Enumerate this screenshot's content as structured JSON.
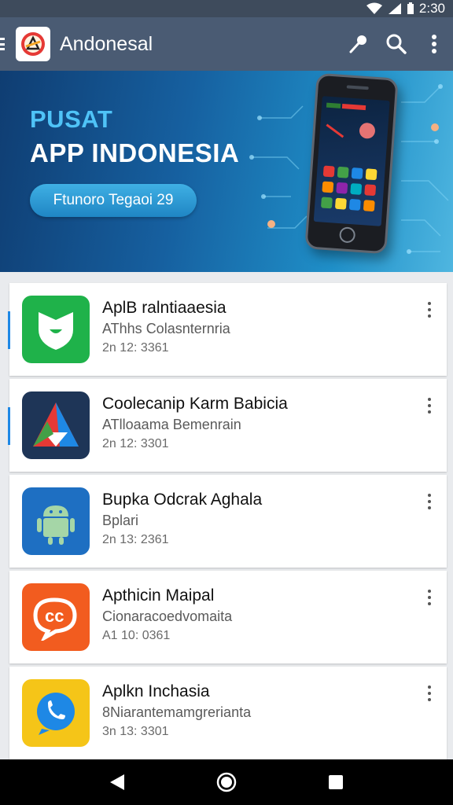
{
  "status_bar": {
    "time": "2:30"
  },
  "app_bar": {
    "title": "Andonesal"
  },
  "banner": {
    "pre_title": "PUSAT",
    "title": "APP INDONESIA",
    "cta_label": "Ftunoro Tegaoi 29"
  },
  "apps": [
    {
      "name": "AplB ralntiaaesia",
      "subtitle": "AThhs Colasnternria",
      "meta": "2n 12: 3361",
      "icon": "shield-app-icon",
      "color": "#1fb24a",
      "accent": true
    },
    {
      "name": "Coolecanip Karm Babicia",
      "subtitle": "ATlloaama Bemenrain",
      "meta": "2n 12: 3301",
      "icon": "triangle-app-icon",
      "color": "#1e3557",
      "accent": true
    },
    {
      "name": "Bupka Odcrak Aghala",
      "subtitle": "Bplari",
      "meta": "2n 13: 2361",
      "icon": "android-icon",
      "color": "#1e6fc2",
      "accent": false
    },
    {
      "name": "Apthicin Maipal",
      "subtitle": "Cionaracoedvomaita",
      "meta": "A1 10: 0361",
      "icon": "chat-c-icon",
      "color": "#f25c1f",
      "accent": false
    },
    {
      "name": "Aplkn Inchasia",
      "subtitle": "8Niarantemamgrerianta",
      "meta": "3n 13: 3301",
      "icon": "phone-chat-icon",
      "color": "#f5c518",
      "accent": false
    }
  ],
  "colors": {
    "app_bar": "#4a5b73",
    "status_bar": "#3e4b5c",
    "banner_accent": "#4fc3f7"
  }
}
